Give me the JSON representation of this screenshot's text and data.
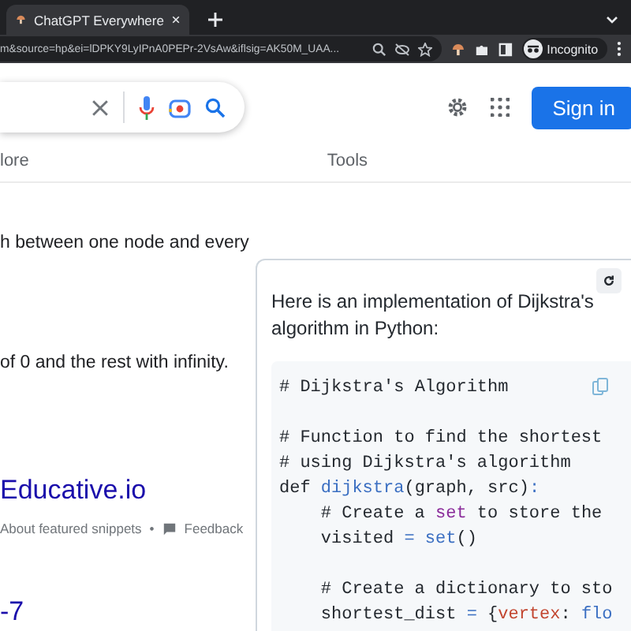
{
  "browser": {
    "tab_title": "ChatGPT Everywhere",
    "url": "m&source=hp&ei=lDPKY9LyIPnA0PEPr-2VsAw&iflsig=AK50M_UAA...",
    "profile": "Incognito"
  },
  "header": {
    "sign_in": "Sign in"
  },
  "nav": {
    "items": [
      "lore",
      "Tools"
    ]
  },
  "results": {
    "lines": [
      "h between one node and every",
      "of 0 and the rest with infinity."
    ],
    "source_link": "Educative.io",
    "about": "About featured snippets",
    "separator": "•",
    "feedback": "Feedback",
    "next_title": "-7"
  },
  "assistant": {
    "intro": "Here is an implementation of Dijkstra's algorithm in Python:",
    "code": [
      {
        "indent": false,
        "gap_before": false,
        "parts": [
          {
            "kind": "comment",
            "t": "# Dijkstra's Algorithm"
          }
        ]
      },
      {
        "indent": false,
        "gap_before": true,
        "parts": [
          {
            "kind": "comment",
            "t": "# Function to find the shortest"
          }
        ]
      },
      {
        "indent": false,
        "gap_before": false,
        "parts": [
          {
            "kind": "comment",
            "t": "# using Dijkstra's algorithm"
          }
        ]
      },
      {
        "indent": false,
        "gap_before": false,
        "parts": [
          {
            "kind": "keyword",
            "t": "def "
          },
          {
            "kind": "func",
            "t": "dijkstra"
          },
          {
            "kind": "plain",
            "t": "(graph, src)"
          },
          {
            "kind": "op",
            "t": ":"
          }
        ]
      },
      {
        "indent": true,
        "gap_before": false,
        "parts": [
          {
            "kind": "comment",
            "t": "# Create a "
          },
          {
            "kind": "builtin",
            "t": "set"
          },
          {
            "kind": "comment",
            "t": " to store the"
          }
        ]
      },
      {
        "indent": true,
        "gap_before": false,
        "parts": [
          {
            "kind": "plain",
            "t": "visited "
          },
          {
            "kind": "op",
            "t": "= "
          },
          {
            "kind": "func",
            "t": "set"
          },
          {
            "kind": "plain",
            "t": "()"
          }
        ]
      },
      {
        "indent": true,
        "gap_before": true,
        "parts": [
          {
            "kind": "comment",
            "t": "# Create a dictionary to sto"
          }
        ]
      },
      {
        "indent": true,
        "gap_before": false,
        "parts": [
          {
            "kind": "plain",
            "t": "shortest_dist "
          },
          {
            "kind": "op",
            "t": "= "
          },
          {
            "kind": "plain",
            "t": "{"
          },
          {
            "kind": "param",
            "t": "vertex"
          },
          {
            "kind": "plain",
            "t": ": "
          },
          {
            "kind": "func",
            "t": "flo"
          }
        ]
      }
    ]
  }
}
